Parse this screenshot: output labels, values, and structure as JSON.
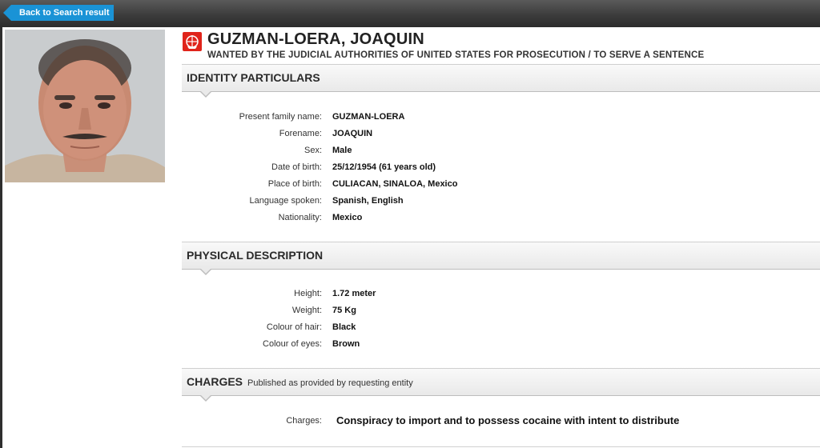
{
  "nav": {
    "back_label": "Back to Search result"
  },
  "notice": {
    "name": "GUZMAN-LOERA, JOAQUIN",
    "subtitle": "WANTED BY THE JUDICIAL AUTHORITIES OF UNITED STATES FOR PROSECUTION / TO SERVE A SENTENCE"
  },
  "identity": {
    "heading": "IDENTITY PARTICULARS",
    "rows": [
      {
        "label": "Present family name:",
        "value": "GUZMAN-LOERA"
      },
      {
        "label": "Forename:",
        "value": "JOAQUIN"
      },
      {
        "label": "Sex:",
        "value": "Male"
      },
      {
        "label": "Date of birth:",
        "value": "25/12/1954 (61 years old)"
      },
      {
        "label": "Place of birth:",
        "value": "CULIACAN, SINALOA, Mexico"
      },
      {
        "label": "Language spoken:",
        "value": "Spanish, English"
      },
      {
        "label": "Nationality:",
        "value": "Mexico"
      }
    ]
  },
  "physical": {
    "heading": "PHYSICAL DESCRIPTION",
    "rows": [
      {
        "label": "Height:",
        "value": "1.72 meter"
      },
      {
        "label": "Weight:",
        "value": "75 Kg"
      },
      {
        "label": "Colour of hair:",
        "value": "Black"
      },
      {
        "label": "Colour of eyes:",
        "value": "Brown"
      }
    ]
  },
  "charges": {
    "heading": "CHARGES",
    "note": "Published as provided by requesting entity",
    "label": "Charges:",
    "value": "Conspiracy to import and to possess cocaine with intent to distribute"
  },
  "colors": {
    "back_button": "#1a93d6",
    "logo": "#e0241b",
    "topbar": "#3a3a3a"
  }
}
